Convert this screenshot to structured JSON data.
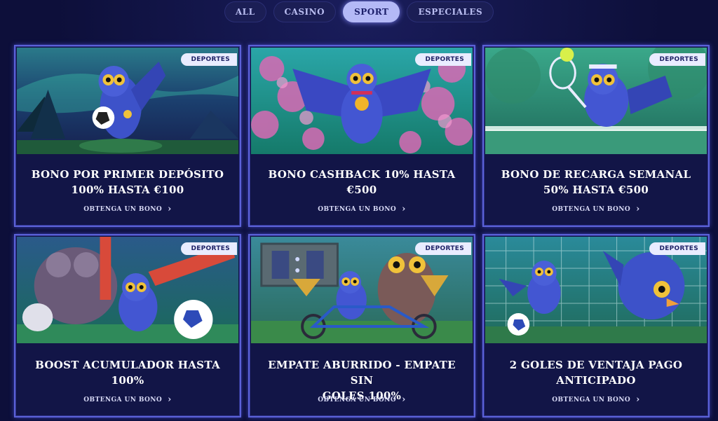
{
  "tabs": [
    {
      "label": "ALL",
      "active": false
    },
    {
      "label": "CASINO",
      "active": false
    },
    {
      "label": "SPORT",
      "active": true
    },
    {
      "label": "ESPECIALES",
      "active": false
    }
  ],
  "cards": [
    {
      "badge": "DEPORTES",
      "title_line1": "BONO POR PRIMER DEPÓSITO",
      "title_line2": "100% HASTA €100",
      "link": "OBTENGA UN BONO",
      "scene": "owl-with-soccer-ball-aurora"
    },
    {
      "badge": "DEPORTES",
      "title_line1": "BONO CASHBACK 10% HASTA",
      "title_line2": "€500",
      "link": "OBTENGA UN BONO",
      "scene": "owl-with-medal-flowers"
    },
    {
      "badge": "DEPORTES",
      "title_line1": "BONO DE RECARGA SEMANAL",
      "title_line2": "50% HASTA €500",
      "link": "OBTENGA UN BONO",
      "scene": "owl-playing-tennis"
    },
    {
      "badge": "DEPORTES",
      "title_line1": "BOOST ACUMULADOR HASTA",
      "title_line2": "100%",
      "link": "OBTENGA UN BONO",
      "scene": "owls-with-soccer-ball"
    },
    {
      "badge": "DEPORTES",
      "title_line1": "EMPATE ABURRIDO - EMPATE SIN",
      "title_line2": "GOLES 100%",
      "link": "OBTENGA UN BONO",
      "scene": "owls-on-tandem-bike"
    },
    {
      "badge": "DEPORTES",
      "title_line1": "2 GOLES DE VENTAJA PAGO",
      "title_line2": "ANTICIPADO",
      "link": "OBTENGA UN BONO",
      "scene": "owls-goalkeeper-save"
    }
  ],
  "colors": {
    "background": "#0d0f3a",
    "card_border": "#5b61d8",
    "tab_active": "#b4b9f6",
    "badge": "#e9ecff"
  },
  "icons": {
    "chevron": "chevron-right-icon"
  }
}
